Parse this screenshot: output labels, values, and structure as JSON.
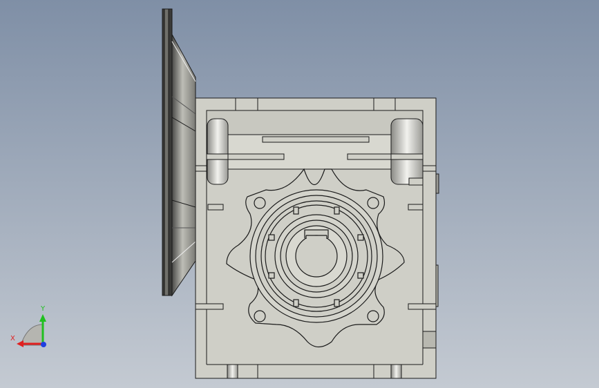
{
  "viewport": {
    "background_top": "#7f8fa6",
    "background_bottom": "#c4cad2",
    "model_fill": "#cfcfc7",
    "model_edge": "#1a1a1a"
  },
  "triad": {
    "x_label": "X",
    "y_label": "Y",
    "x_color": "#e02020",
    "y_color": "#20c020",
    "z_color": "#2040e0"
  }
}
